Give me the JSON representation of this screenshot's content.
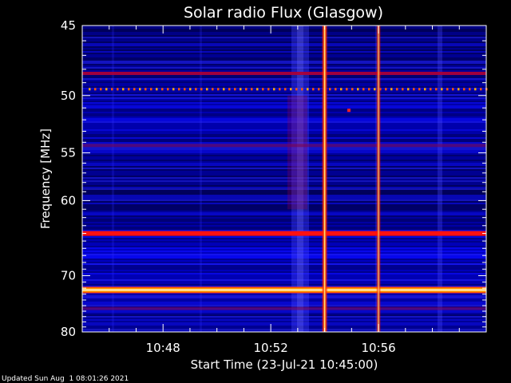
{
  "chart_data": {
    "type": "heatmap",
    "title": "Solar radio Flux (Glasgow)",
    "xlabel": "Start Time (23-Jul-21 10:45:00)",
    "ylabel": "Frequency [MHz]",
    "x_ticks": [
      "10:48",
      "10:52",
      "10:56"
    ],
    "x_tick_minutes_after_start": [
      3,
      7,
      11
    ],
    "xlim_minutes_after_start": [
      0,
      15
    ],
    "y_ticks": [
      45,
      50,
      55,
      60,
      70,
      80
    ],
    "ylim": [
      45,
      80
    ],
    "y_scale": "reciprocal",
    "features": {
      "horizontal_bands_mhz": [
        {
          "freq": 48.3,
          "intensity": "medium"
        },
        {
          "freq": 49.5,
          "intensity": "dotted"
        },
        {
          "freq": 54.3,
          "intensity": "low"
        },
        {
          "freq": 64.0,
          "intensity": "high"
        },
        {
          "freq": 72.3,
          "intensity": "saturated"
        },
        {
          "freq": 75.5,
          "intensity": "low"
        }
      ],
      "vertical_bursts": [
        {
          "time": "10:54:00",
          "intensity": "saturated"
        },
        {
          "time": "10:56:00",
          "intensity": "high"
        }
      ]
    },
    "colormap": [
      "#000000",
      "#00004a",
      "#0000c8",
      "#3a3aff",
      "#ff0000",
      "#ffaa00",
      "#ffffff"
    ]
  },
  "footer_text": "Updated Sun Aug  1 08:01:26 2021"
}
